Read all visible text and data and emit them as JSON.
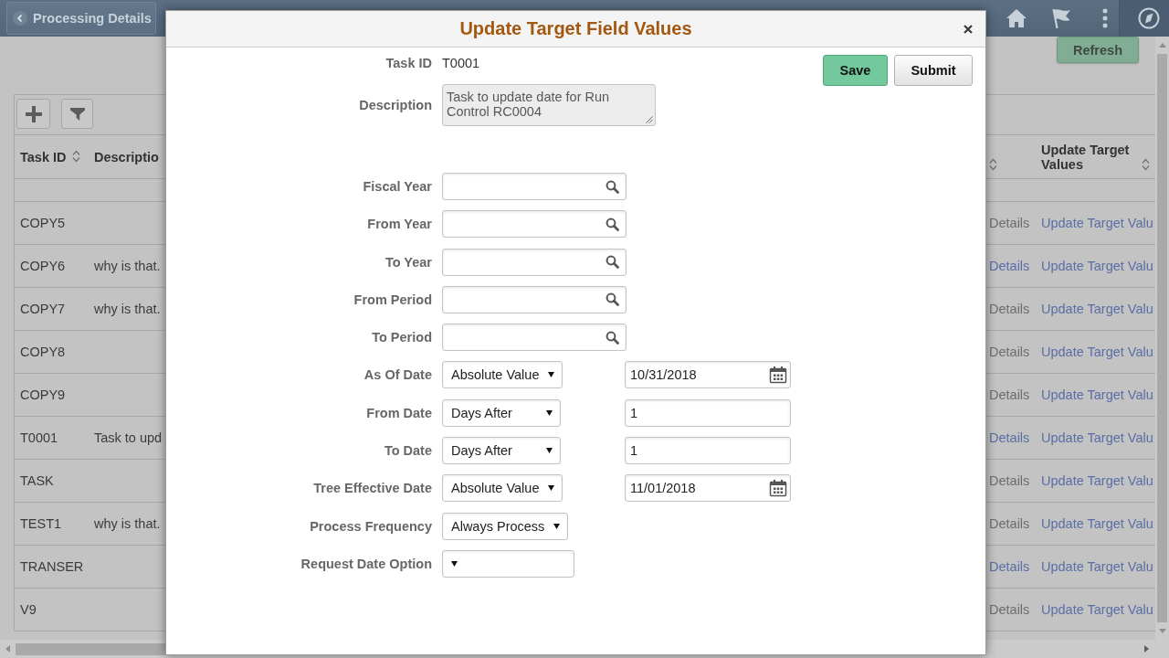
{
  "banner": {
    "back_button": "Processing Details"
  },
  "page": {
    "refresh_button": "Refresh"
  },
  "grid": {
    "columns": [
      {
        "label": "Task ID",
        "sortable": true
      },
      {
        "label": "Descriptio",
        "sortable": false
      },
      {
        "sortable": true
      },
      {
        "label": "Update Target Values",
        "sortable": true
      }
    ],
    "rows": [
      {
        "task_id": "COPY5",
        "column_3": "Details",
        "column_3_enabled": false,
        "update_target_values": "Update Target Valu"
      },
      {
        "task_id": "COPY6",
        "description": "why is that.",
        "column_3": "Details",
        "column_3_enabled": true,
        "update_target_values": "Update Target Valu"
      },
      {
        "task_id": "COPY7",
        "description": "why is that.",
        "column_3": "Details",
        "column_3_enabled": false,
        "update_target_values": "Update Target Valu"
      },
      {
        "task_id": "COPY8",
        "column_3": "Details",
        "column_3_enabled": false,
        "update_target_values": "Update Target Valu"
      },
      {
        "task_id": "COPY9",
        "column_3": "Details",
        "column_3_enabled": false,
        "update_target_values": "Update Target Valu"
      },
      {
        "task_id": "T0001",
        "description": "Task to upd",
        "column_3": "Details",
        "column_3_enabled": true,
        "update_target_values": "Update Target Valu"
      },
      {
        "task_id": "TASK",
        "column_3": "Details",
        "column_3_enabled": false,
        "update_target_values": "Update Target Valu"
      },
      {
        "task_id": "TEST1",
        "description": "why is that.",
        "column_3": "Details",
        "column_3_enabled": false,
        "update_target_values": "Update Target Valu"
      },
      {
        "task_id": "TRANSER",
        "column_3": "Details",
        "column_3_enabled": true,
        "update_target_values": "Update Target Valu"
      },
      {
        "task_id": "V9",
        "column_3": "Details",
        "column_3_enabled": false,
        "update_target_values": "Update Target Valu"
      }
    ]
  },
  "dialog": {
    "title": "Update Target Field Values",
    "buttons": [
      {
        "label": "Save",
        "kind": "primary"
      },
      {
        "label": "Submit",
        "kind": "secondary"
      }
    ],
    "fields": [
      {
        "label": "Task ID",
        "kind": "static",
        "value": "T0001"
      },
      {
        "label": "Description",
        "kind": "textarea",
        "value": "Task to update date for Run Control RC0004"
      },
      {
        "label": "Fiscal Year",
        "kind": "lookup"
      },
      {
        "label": "From Year",
        "kind": "lookup"
      },
      {
        "label": "To Year",
        "kind": "lookup"
      },
      {
        "label": "From Period",
        "kind": "lookup"
      },
      {
        "label": "To Period",
        "kind": "lookup"
      },
      {
        "label": "As Of Date",
        "kind": "select",
        "value": "Absolute Value",
        "second": {
          "kind": "date",
          "value": "10/31/2018"
        }
      },
      {
        "label": "From Date",
        "kind": "select",
        "value": "Days After",
        "second": {
          "kind": "text",
          "value": "1"
        }
      },
      {
        "label": "To Date",
        "kind": "select",
        "value": "Days After",
        "second": {
          "kind": "text",
          "value": "1"
        }
      },
      {
        "label": "Tree Effective Date",
        "kind": "select",
        "value": "Absolute Value",
        "second": {
          "kind": "date",
          "value": "11/01/2018"
        }
      },
      {
        "label": "Process Frequency",
        "kind": "select",
        "value": "Always Process"
      },
      {
        "label": "Request Date Option",
        "kind": "select"
      }
    ]
  }
}
